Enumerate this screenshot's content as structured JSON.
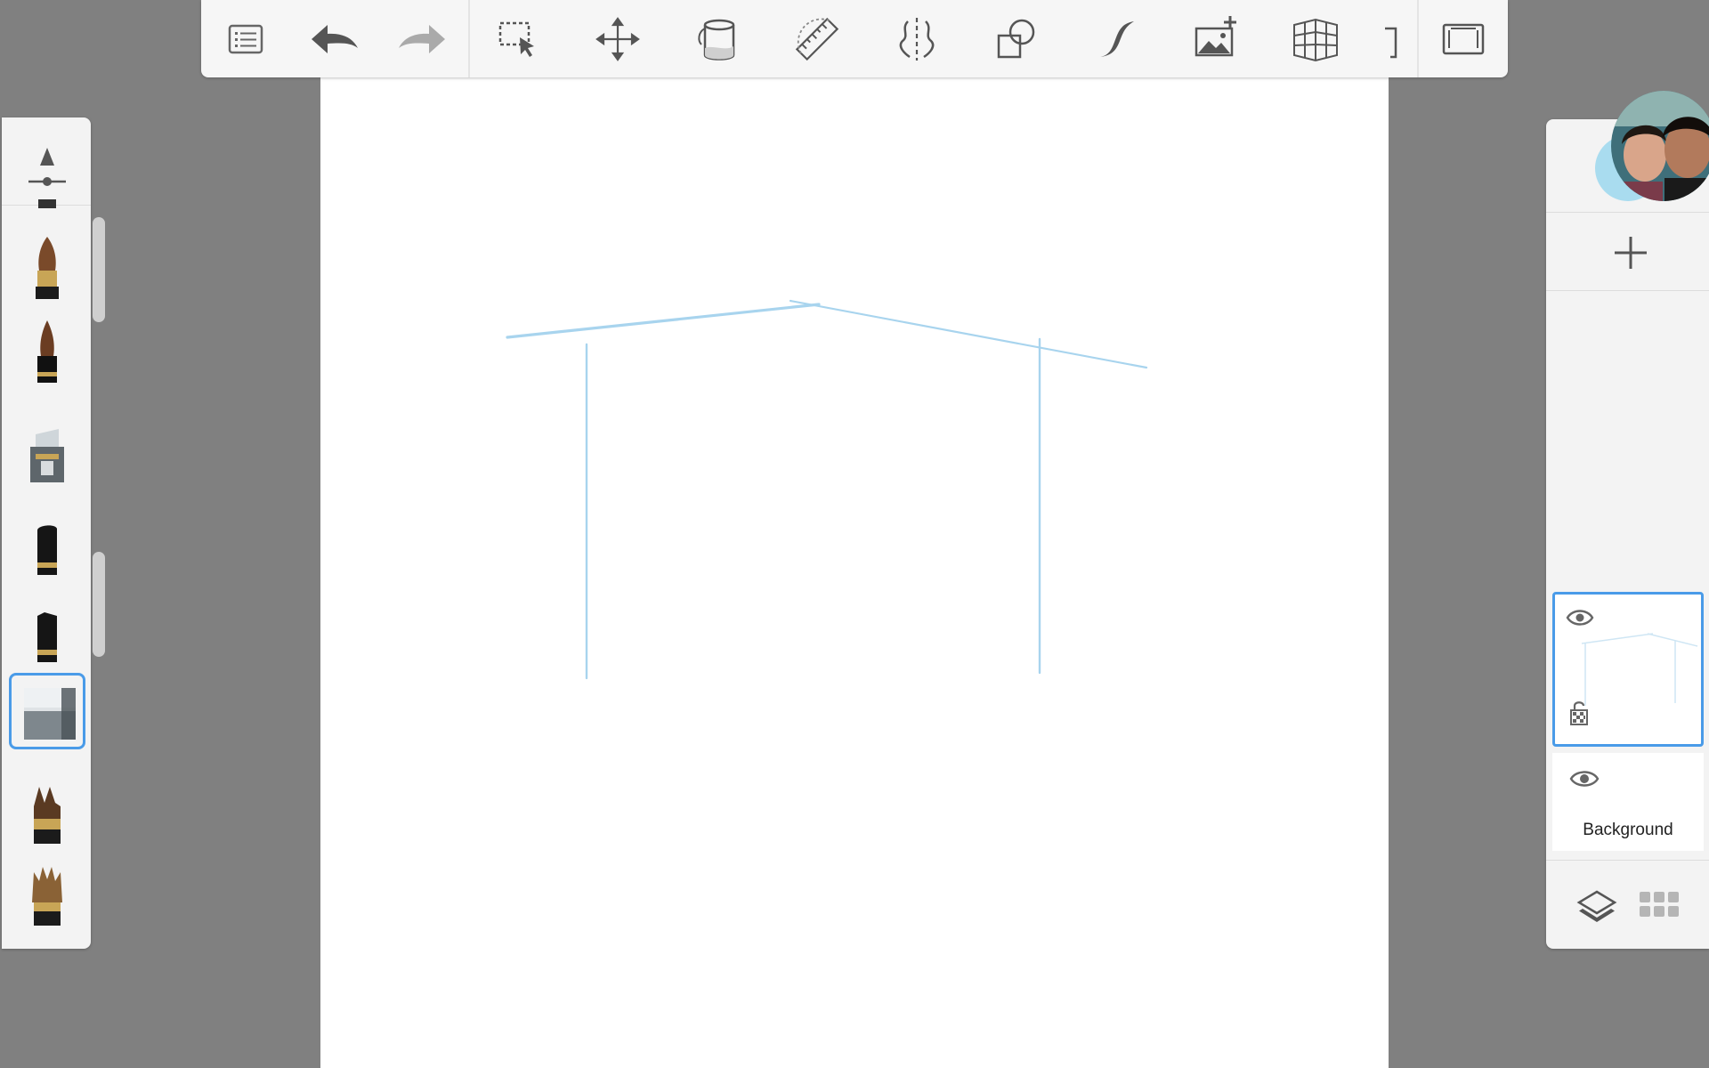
{
  "app": {
    "accent_color": "#4a9be8",
    "stroke_color": "#a8d4ee"
  },
  "toolbar": {
    "tools": [
      {
        "id": "menu",
        "icon": "list-menu-icon"
      },
      {
        "id": "undo",
        "icon": "undo-arrow-icon"
      },
      {
        "id": "redo",
        "icon": "redo-arrow-icon"
      },
      {
        "id": "select",
        "icon": "selection-icon"
      },
      {
        "id": "transform",
        "icon": "move-arrows-icon"
      },
      {
        "id": "fill",
        "icon": "paint-bucket-icon"
      },
      {
        "id": "ruler",
        "icon": "ruler-icon"
      },
      {
        "id": "symmetry",
        "icon": "symmetry-icon"
      },
      {
        "id": "shapes",
        "icon": "shapes-icon"
      },
      {
        "id": "stroke",
        "icon": "curve-stroke-icon"
      },
      {
        "id": "add-image",
        "icon": "add-image-icon"
      },
      {
        "id": "perspective",
        "icon": "perspective-grid-icon"
      },
      {
        "id": "text",
        "icon": "text-icon"
      },
      {
        "id": "fullscreen",
        "icon": "fullscreen-icon"
      }
    ]
  },
  "brushes": {
    "selected": "hard-eraser",
    "items": [
      {
        "id": "brush-properties",
        "icon": "brush-properties-icon"
      },
      {
        "id": "paintbrush",
        "icon": "paintbrush-icon"
      },
      {
        "id": "ink-brush",
        "icon": "ink-brush-icon"
      },
      {
        "id": "airbrush",
        "icon": "airbrush-icon"
      },
      {
        "id": "chisel-marker",
        "icon": "chisel-marker-icon"
      },
      {
        "id": "marker",
        "icon": "marker-icon"
      },
      {
        "id": "hard-eraser",
        "icon": "eraser-icon"
      },
      {
        "id": "flat-brush",
        "icon": "flat-brush-icon"
      },
      {
        "id": "fan-brush",
        "icon": "fan-brush-icon"
      }
    ]
  },
  "layers": {
    "items": [
      {
        "name": "",
        "visible": true,
        "locked": false,
        "active": true
      },
      {
        "name": "Background",
        "visible": true,
        "active": false
      }
    ],
    "footer": {
      "layers_icon": "layers-stack-icon",
      "grid_icon": "grid-view-icon"
    }
  }
}
